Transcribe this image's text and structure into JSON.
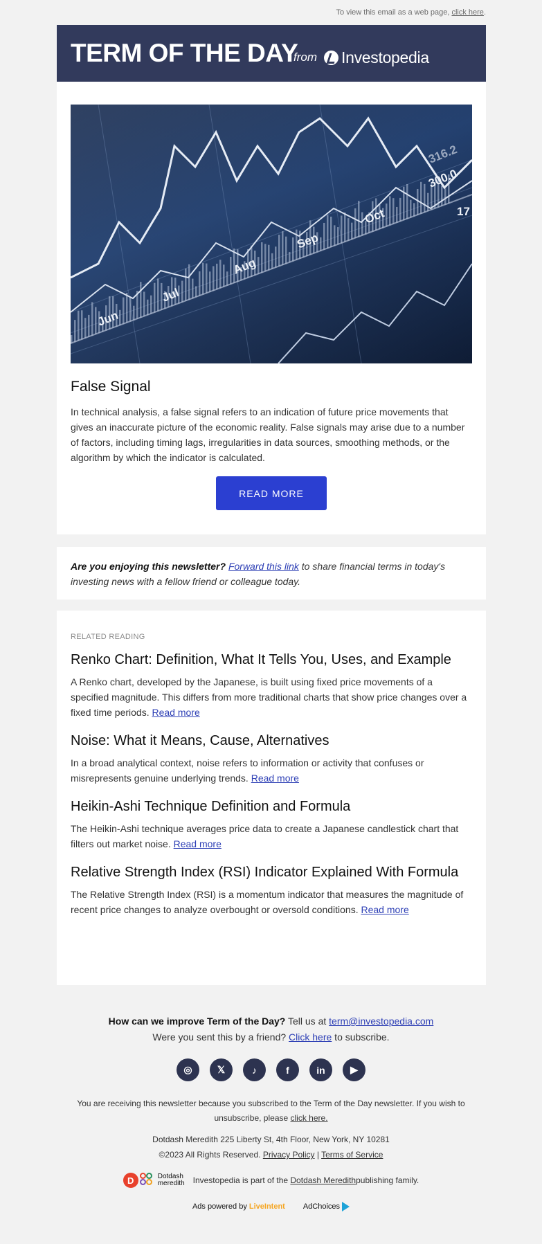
{
  "topbar": {
    "text": "To view this email as a web page,",
    "link": "click here",
    "suffix": "."
  },
  "header": {
    "title": "TERM OF THE DAY",
    "from": "from",
    "brand": "Investopedia"
  },
  "hero": {
    "image_tick_labels": [
      "Jun",
      "Jul",
      "Aug",
      "Sep",
      "Oct",
      "300.0",
      "316.2",
      "17"
    ],
    "term": "False Signal",
    "definition": "In technical analysis, a false signal refers to an indication of future price movements that gives an inaccurate picture of the economic reality. False signals may arise due to a number of factors, including timing lags, irregularities in data sources, smoothing methods, or the algorithm by which the indicator is calculated.",
    "button": "READ MORE"
  },
  "share": {
    "question": "Are you enjoying this newsletter?",
    "link": "Forward this link",
    "rest": " to share financial terms in today's investing news with a fellow friend or colleague today."
  },
  "related": {
    "kicker": "RELATED READING",
    "read_more": "Read more",
    "items": [
      {
        "title": "Renko Chart: Definition, What It Tells You, Uses, and Example",
        "body": "A Renko chart, developed by the Japanese, is built using fixed price movements of a specified magnitude. This differs from more traditional charts that show price changes over a fixed time periods. "
      },
      {
        "title": "Noise: What it Means, Cause, Alternatives",
        "body": "In a broad analytical context, noise refers to information or activity that confuses or misrepresents genuine underlying trends. "
      },
      {
        "title": "Heikin-Ashi Technique Definition and Formula",
        "body": "The Heikin-Ashi technique averages price data to create a Japanese candlestick chart that filters out market noise. "
      },
      {
        "title": "Relative Strength Index (RSI) Indicator Explained With Formula",
        "body": "The Relative Strength Index (RSI) is a momentum indicator that measures the magnitude of recent price changes to analyze overbought or oversold conditions. "
      }
    ]
  },
  "footer": {
    "improve_q": "How can we improve Term of the Day?",
    "improve_text": " Tell us at ",
    "email": "term@investopedia.com",
    "friend_text": "Were you sent this by a friend? ",
    "friend_link": "Click here",
    "friend_suffix": " to subscribe.",
    "socials": [
      {
        "icon": "instagram-icon",
        "glyph": "◎"
      },
      {
        "icon": "x-icon",
        "glyph": "𝕏"
      },
      {
        "icon": "tiktok-icon",
        "glyph": "♪"
      },
      {
        "icon": "facebook-icon",
        "glyph": "f"
      },
      {
        "icon": "linkedin-icon",
        "glyph": "in"
      },
      {
        "icon": "youtube-icon",
        "glyph": "▶"
      }
    ],
    "legal": "You are receiving this newsletter because you subscribed to the Term of the Day newsletter. If you wish to unsubscribe, please ",
    "unsubscribe": "click here.",
    "address": "Dotdash Meredith 225 Liberty St, 4th Floor, New York, NY 10281",
    "copyright": "©2023 All Rights Reserved. ",
    "privacy": "Privacy Policy",
    "sep": " | ",
    "terms": "Terms of Service",
    "dm_logo_line1": "Dotdash",
    "dm_logo_line2": "meredith",
    "family_text": "Investopedia is part of the ",
    "family_link": "Dotdash Meredith",
    "family_suffix": " publishing family.",
    "ads_text": "Ads powered by",
    "liveintent": "LiveIntent",
    "adchoices": "AdChoices"
  },
  "colors": {
    "header_bg": "#323a5c",
    "button_bg": "#2b3fd1",
    "link": "#2d3fb5",
    "page_bg": "#f2f2f2"
  }
}
